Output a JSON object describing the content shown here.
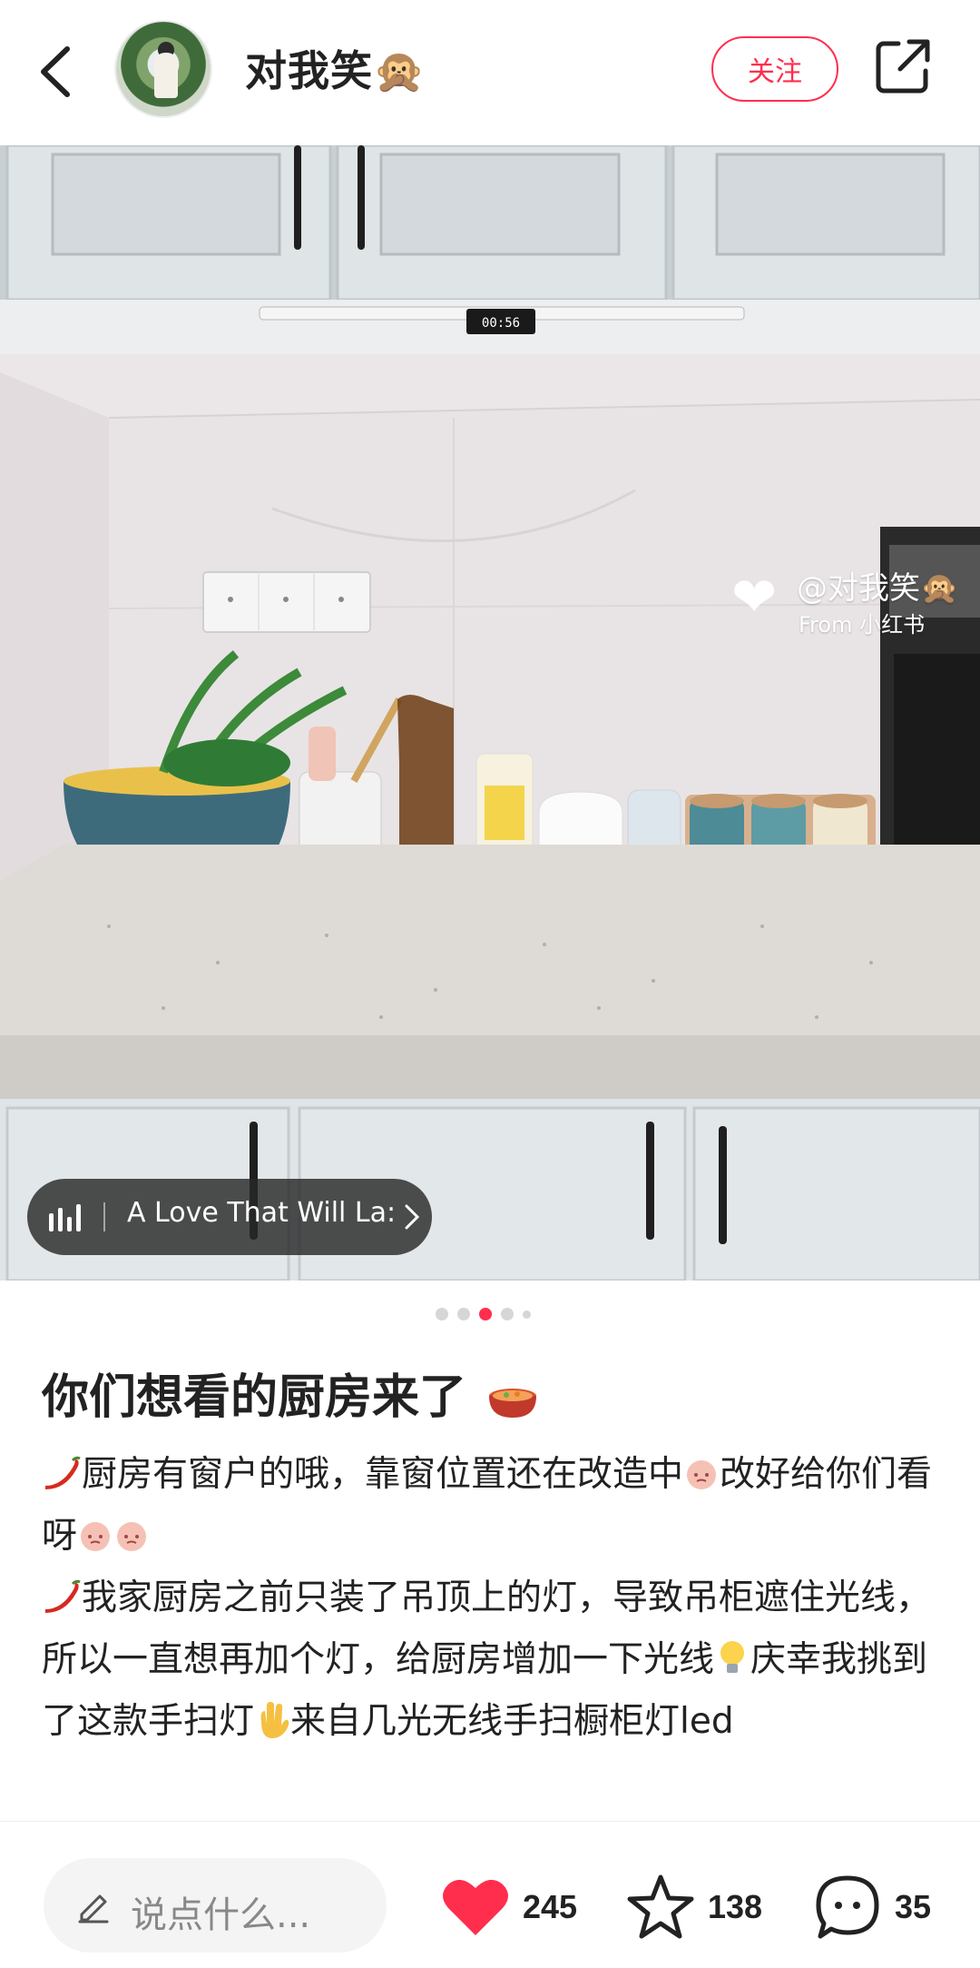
{
  "header": {
    "username": "对我笑🙊",
    "follow_label": "关注"
  },
  "photo": {
    "watermark_handle": "@对我笑🙊",
    "watermark_source": "From 小红书",
    "clock_display": "00:56",
    "music_title": "A Love That Will La:",
    "carousel": {
      "total": 5,
      "active_index": 2
    }
  },
  "post": {
    "title": "你们想看的厨房来了",
    "line1_a": "厨房有窗户的哦，靠窗位置还在改造中",
    "line1_b": "改好给你们看呀",
    "line2": "我家厨房之前只装了吊顶上的灯，导致吊柜遮住光线，所以一直想再加个灯，给厨房增加一下光线",
    "line2_b": "庆幸我挑到了这款手扫灯",
    "line2_c": "来自几光无线手扫橱柜灯led"
  },
  "bottom_bar": {
    "comment_placeholder": "说点什么...",
    "likes": "245",
    "favorites": "138",
    "comments": "35"
  },
  "colors": {
    "accent": "#ff2e4d",
    "text": "#222222",
    "muted": "#888888"
  },
  "icons": [
    "back-arrow-icon",
    "share-icon",
    "music-bars-icon",
    "chevron-right-icon",
    "pencil-icon",
    "heart-icon",
    "star-icon",
    "comment-bubble-icon"
  ]
}
